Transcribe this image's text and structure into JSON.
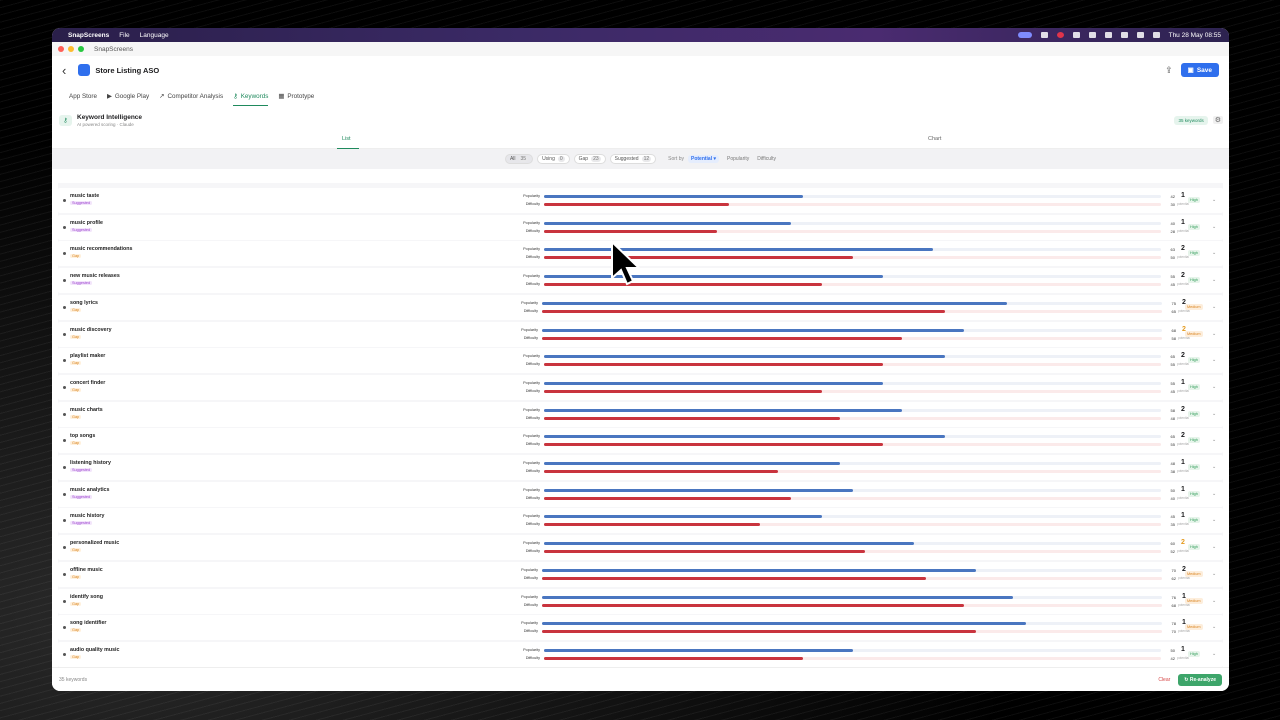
{
  "menubar": {
    "app": "SnapScreens",
    "items": [
      "File",
      "Language"
    ],
    "clock": "Thu 28 May  08:55"
  },
  "window": {
    "title": "SnapScreens"
  },
  "header": {
    "title": "Store Listing ASO",
    "save_label": "Save"
  },
  "tabs": [
    {
      "label": "App Store",
      "icon": "apple-icon"
    },
    {
      "label": "Google Play",
      "icon": "play-icon"
    },
    {
      "label": "Competitor Analysis",
      "icon": "trend-icon"
    },
    {
      "label": "Keywords",
      "icon": "key-icon",
      "active": true
    },
    {
      "label": "Prototype",
      "icon": "grid-icon"
    }
  ],
  "panel": {
    "title": "Keyword Intelligence",
    "subtitle": "AI powered scoring · Claude",
    "count_badge": "35 keywords"
  },
  "view_tabs": {
    "list": "List",
    "chart": "Chart"
  },
  "filters": {
    "chips": [
      {
        "label": "All",
        "count": "35",
        "active": true
      },
      {
        "label": "Using",
        "count": "0"
      },
      {
        "label": "Gap",
        "count": "23"
      },
      {
        "label": "Suggested",
        "count": "12"
      }
    ],
    "sort_label": "Sort by",
    "sort_selected": "Potential ▾",
    "sort_options": [
      "Popularity",
      "Difficulty"
    ]
  },
  "row_labels": {
    "popularity": "Popularity",
    "difficulty": "Difficulty",
    "rank_label": "potential"
  },
  "keywords": [
    {
      "keyword": "music taste",
      "tag": "Suggested",
      "popularity": 42,
      "difficulty": 30,
      "rank": "1",
      "level": "High"
    },
    {
      "keyword": "music profile",
      "tag": "Suggested",
      "popularity": 40,
      "difficulty": 28,
      "rank": "1",
      "level": "High"
    },
    {
      "keyword": "music recommendations",
      "tag": "Gap",
      "popularity": 63,
      "difficulty": 50,
      "rank": "2",
      "level": "High"
    },
    {
      "keyword": "new music releases",
      "tag": "Suggested",
      "popularity": 55,
      "difficulty": 45,
      "rank": "2",
      "level": "High"
    },
    {
      "keyword": "song lyrics",
      "tag": "Gap",
      "popularity": 75,
      "difficulty": 65,
      "rank": "2",
      "level": "Medium"
    },
    {
      "keyword": "music discovery",
      "tag": "Gap",
      "popularity": 68,
      "difficulty": 58,
      "rank": "2",
      "level": "Medium",
      "rank_color": "orange"
    },
    {
      "keyword": "playlist maker",
      "tag": "Gap",
      "popularity": 65,
      "difficulty": 55,
      "rank": "2",
      "level": "High"
    },
    {
      "keyword": "concert finder",
      "tag": "Gap",
      "popularity": 55,
      "difficulty": 45,
      "rank": "1",
      "level": "High"
    },
    {
      "keyword": "music charts",
      "tag": "Gap",
      "popularity": 58,
      "difficulty": 48,
      "rank": "2",
      "level": "High"
    },
    {
      "keyword": "top songs",
      "tag": "Gap",
      "popularity": 65,
      "difficulty": 55,
      "rank": "2",
      "level": "High"
    },
    {
      "keyword": "listening history",
      "tag": "Suggested",
      "popularity": 48,
      "difficulty": 38,
      "rank": "1",
      "level": "High"
    },
    {
      "keyword": "music analytics",
      "tag": "Suggested",
      "popularity": 50,
      "difficulty": 40,
      "rank": "1",
      "level": "High"
    },
    {
      "keyword": "music history",
      "tag": "Suggested",
      "popularity": 45,
      "difficulty": 35,
      "rank": "1",
      "level": "High"
    },
    {
      "keyword": "personalized music",
      "tag": "Gap",
      "popularity": 60,
      "difficulty": 52,
      "rank": "2",
      "level": "High",
      "rank_color": "orange"
    },
    {
      "keyword": "offline music",
      "tag": "Gap",
      "popularity": 70,
      "difficulty": 62,
      "rank": "2",
      "level": "Medium"
    },
    {
      "keyword": "identify song",
      "tag": "Gap",
      "popularity": 76,
      "difficulty": 68,
      "rank": "1",
      "level": "Medium"
    },
    {
      "keyword": "song identifier",
      "tag": "Gap",
      "popularity": 78,
      "difficulty": 70,
      "rank": "1",
      "level": "Medium"
    },
    {
      "keyword": "audio quality music",
      "tag": "Gap",
      "popularity": 50,
      "difficulty": 42,
      "rank": "1",
      "level": "High"
    }
  ],
  "footer": {
    "count": "35 keywords",
    "clear": "Clear",
    "reanalyze": "Re-analyze"
  }
}
